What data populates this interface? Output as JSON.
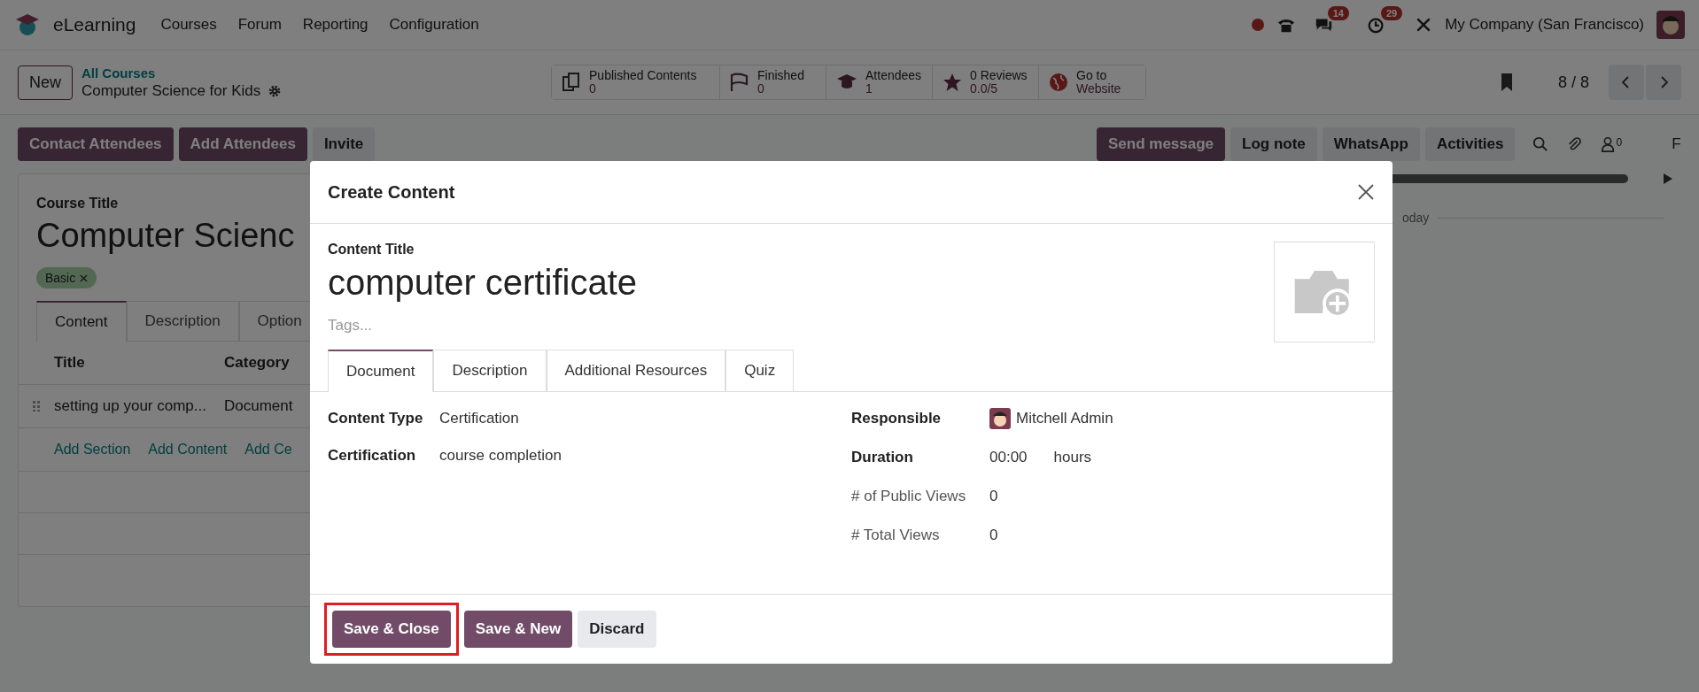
{
  "navbar": {
    "app_name": "eLearning",
    "menus": [
      "Courses",
      "Forum",
      "Reporting",
      "Configuration"
    ],
    "badges": [
      {
        "kind": "chat",
        "count": "14"
      },
      {
        "kind": "activity",
        "count": "29"
      }
    ],
    "company": "My Company (San Francisco)"
  },
  "control_panel": {
    "new_button": "New",
    "breadcrumb_parent": "All Courses",
    "breadcrumb_current": "Computer Science for Kids",
    "stats": [
      {
        "kind": "contents",
        "label": "Published Contents",
        "value": "0"
      },
      {
        "kind": "finished",
        "label": "Finished",
        "value": "0"
      },
      {
        "kind": "attendees",
        "label": "Attendees",
        "value": "1"
      },
      {
        "kind": "reviews",
        "label": "0 Reviews",
        "value": "0.0/5"
      },
      {
        "kind": "website",
        "label": "Go to",
        "value": "Website"
      }
    ],
    "pager": "8 / 8"
  },
  "actions": [
    {
      "label": "Contact Attendees",
      "kind": "primary"
    },
    {
      "label": "Add Attendees",
      "kind": "primary"
    },
    {
      "label": "Invite",
      "kind": "secondary"
    }
  ],
  "chatter": {
    "buttons": [
      {
        "label": "Send message",
        "kind": "primary"
      },
      {
        "label": "Log note",
        "kind": "secondary"
      },
      {
        "label": "WhatsApp",
        "kind": "secondary"
      },
      {
        "label": "Activities",
        "kind": "secondary"
      }
    ],
    "followers_count": "0",
    "follow_label": "F",
    "date_separator": "oday"
  },
  "course": {
    "label": "Course Title",
    "title": "Computer Scienc",
    "tags": [
      "Basic"
    ],
    "tabs": [
      {
        "label": "Content",
        "selected": true
      },
      {
        "label": "Description",
        "selected": false
      },
      {
        "label": "Option",
        "selected": false
      }
    ],
    "columns": [
      "Title",
      "Category"
    ],
    "rows": [
      {
        "title": "setting up your comp...",
        "category": "Document"
      }
    ],
    "add_links": [
      "Add Section",
      "Add Content",
      "Add Ce"
    ]
  },
  "dialog": {
    "title": "Create Content",
    "title_label": "Content Title",
    "content_title": "computer certificate",
    "tags_placeholder": "Tags...",
    "tabs": [
      {
        "label": "Document",
        "selected": true
      },
      {
        "label": "Description",
        "selected": false
      },
      {
        "label": "Additional Resources",
        "selected": false
      },
      {
        "label": "Quiz",
        "selected": false
      }
    ],
    "left_fields": [
      {
        "label": "Content Type",
        "value": "Certification"
      },
      {
        "label": "Certification",
        "value": "course completion"
      }
    ],
    "right_fields": [
      {
        "kind": "user",
        "label": "Responsible",
        "value": "Mitchell Admin"
      },
      {
        "kind": "duration",
        "label": "Duration",
        "value": "00:00",
        "unit": "hours"
      },
      {
        "kind": "plain",
        "label": "# of Public Views",
        "value": "0"
      },
      {
        "kind": "plain",
        "label": "# Total Views",
        "value": "0"
      }
    ],
    "buttons": [
      {
        "label": "Save & Close",
        "kind": "primary",
        "highlighted": true
      },
      {
        "label": "Save & New",
        "kind": "primary",
        "highlighted": false
      },
      {
        "label": "Discard",
        "kind": "secondary",
        "highlighted": false
      }
    ]
  }
}
